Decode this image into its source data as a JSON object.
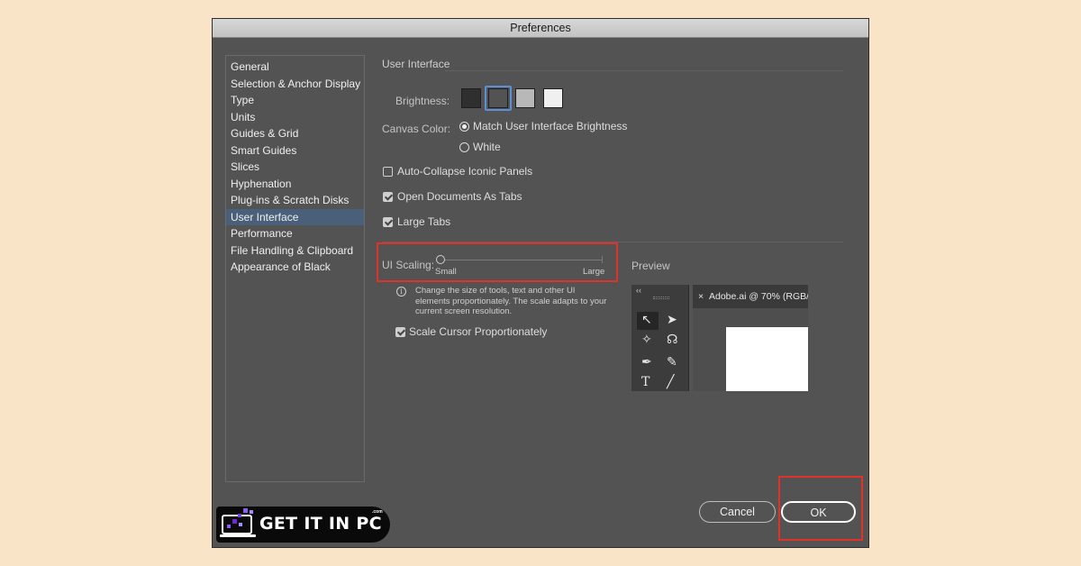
{
  "window": {
    "title": "Preferences"
  },
  "sidebar": {
    "items": [
      {
        "label": "General"
      },
      {
        "label": "Selection & Anchor Display"
      },
      {
        "label": "Type"
      },
      {
        "label": "Units"
      },
      {
        "label": "Guides & Grid"
      },
      {
        "label": "Smart Guides"
      },
      {
        "label": "Slices"
      },
      {
        "label": "Hyphenation"
      },
      {
        "label": "Plug-ins & Scratch Disks"
      },
      {
        "label": "User Interface",
        "selected": true
      },
      {
        "label": "Performance"
      },
      {
        "label": "File Handling & Clipboard"
      },
      {
        "label": "Appearance of Black"
      }
    ]
  },
  "ui": {
    "section_title": "User Interface",
    "brightness_label": "Brightness:",
    "brightness_swatches": [
      {
        "color": "#2f2f2f",
        "selected": false
      },
      {
        "color": "#535353",
        "selected": true
      },
      {
        "color": "#b8b8b8",
        "selected": false
      },
      {
        "color": "#f0f0f0",
        "selected": false
      }
    ],
    "canvas_color_label": "Canvas Color:",
    "canvas_options": [
      {
        "label": "Match User Interface Brightness",
        "selected": true
      },
      {
        "label": "White",
        "selected": false
      }
    ],
    "checkboxes": [
      {
        "label": "Auto-Collapse Iconic Panels",
        "checked": false
      },
      {
        "label": "Open Documents As Tabs",
        "checked": true
      },
      {
        "label": "Large Tabs",
        "checked": true
      }
    ],
    "scaling": {
      "label": "UI Scaling:",
      "min_label": "Small",
      "max_label": "Large",
      "value": 0
    },
    "scaling_info": "Change the size of tools, text and other UI elements proportionately. The scale adapts to your current screen resolution.",
    "scale_cursor": {
      "label": "Scale Cursor Proportionately",
      "checked": true
    },
    "preview": {
      "label": "Preview",
      "doc_tab": "Adobe.ai @ 70% (RGB/",
      "collapse": "‹‹",
      "close": "×"
    }
  },
  "buttons": {
    "cancel": "Cancel",
    "ok": "OK"
  },
  "watermark": {
    "text": "GET IT IN PC",
    "domain": ".com"
  },
  "colors": {
    "highlight": "#e0322b",
    "selection": "#4a5f7a",
    "accent": "#5b8fd6"
  }
}
